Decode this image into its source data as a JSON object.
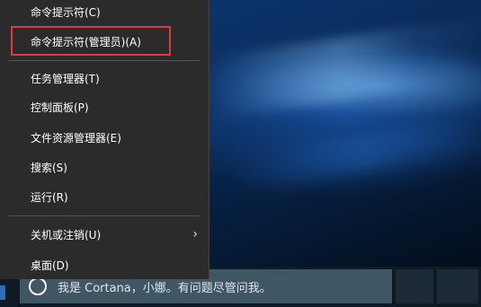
{
  "menu": {
    "items": [
      {
        "label": "命令提示符(C)"
      },
      {
        "label": "命令提示符(管理员)(A)",
        "highlighted": true
      },
      {
        "label": "任务管理器(T)"
      },
      {
        "label": "控制面板(P)"
      },
      {
        "label": "文件资源管理器(E)"
      },
      {
        "label": "搜索(S)"
      },
      {
        "label": "运行(R)"
      },
      {
        "label": "关机或注销(U)",
        "has_submenu": true,
        "submenu_icon": "chevron-right-icon"
      },
      {
        "label": "桌面(D)"
      }
    ],
    "highlight_color": "#e0393b"
  },
  "taskbar": {
    "cortana_placeholder": "我是 Cortana，小娜。有问题尽管问我。",
    "cortana_icon": "cortana-ring-icon"
  }
}
